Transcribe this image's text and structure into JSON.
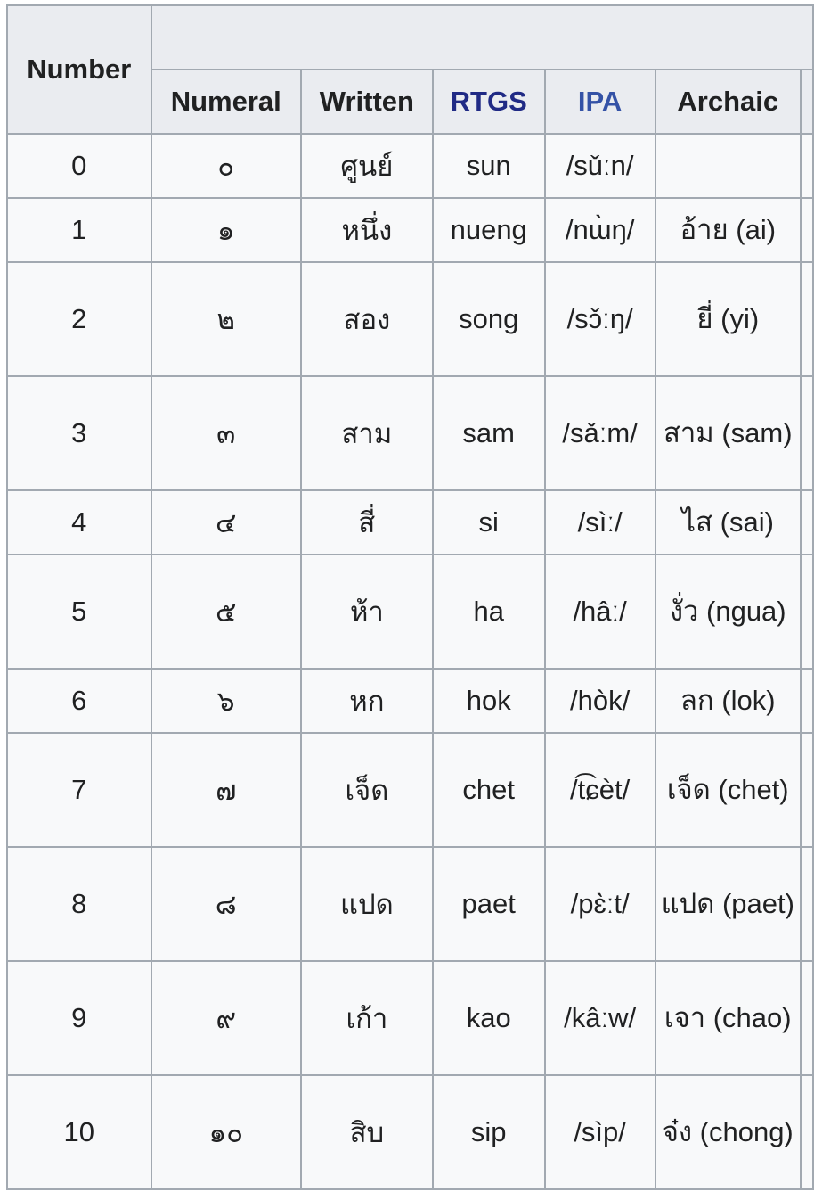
{
  "headers": {
    "number": "Number",
    "numeral": "Numeral",
    "written": "Written",
    "rtgs": "RTGS",
    "ipa": "IPA",
    "archaic": "Archaic"
  },
  "link_colors": {
    "rtgs": "#202a85",
    "ipa": "#3452a6"
  },
  "rows": [
    {
      "number": "0",
      "numeral": "๐",
      "written": "ศูนย์",
      "rtgs": "sun",
      "ipa": "/sǔːn/",
      "archaic": ""
    },
    {
      "number": "1",
      "numeral": "๑",
      "written": "หนึ่ง",
      "rtgs": "nueng",
      "ipa": "/nɯ̀ŋ/",
      "archaic": "อ้าย (ai)"
    },
    {
      "number": "2",
      "numeral": "๒",
      "written": "สอง",
      "rtgs": "song",
      "ipa": "/sɔ̌ːŋ/",
      "archaic": "ยี่ (yi)"
    },
    {
      "number": "3",
      "numeral": "๓",
      "written": "สาม",
      "rtgs": "sam",
      "ipa": "/sǎːm/",
      "archaic": "สาม (sam)"
    },
    {
      "number": "4",
      "numeral": "๔",
      "written": "สี่",
      "rtgs": "si",
      "ipa": "/sìː/",
      "archaic": "ไส (sai)"
    },
    {
      "number": "5",
      "numeral": "๕",
      "written": "ห้า",
      "rtgs": "ha",
      "ipa": "/hâː/",
      "archaic": "งั่ว (ngua)"
    },
    {
      "number": "6",
      "numeral": "๖",
      "written": "หก",
      "rtgs": "hok",
      "ipa": "/hòk/",
      "archaic": "ลก (lok)"
    },
    {
      "number": "7",
      "numeral": "๗",
      "written": "เจ็ด",
      "rtgs": "chet",
      "ipa": "/t͡ɕèt/",
      "archaic": "เจ็ด (chet)"
    },
    {
      "number": "8",
      "numeral": "๘",
      "written": "แปด",
      "rtgs": "paet",
      "ipa": "/pɛ̀ːt/",
      "archaic": "แปด (paet)"
    },
    {
      "number": "9",
      "numeral": "๙",
      "written": "เก้า",
      "rtgs": "kao",
      "ipa": "/kâːw/",
      "archaic": "เจา (chao)"
    },
    {
      "number": "10",
      "numeral": "๑๐",
      "written": "สิบ",
      "rtgs": "sip",
      "ipa": "/sìp/",
      "archaic": "จ๋ง (chong)"
    }
  ]
}
